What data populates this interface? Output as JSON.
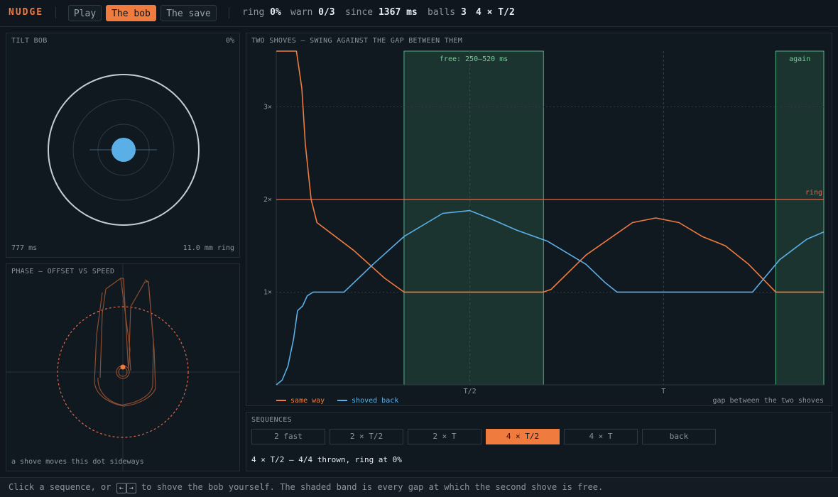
{
  "app": {
    "brand": "NUDGE"
  },
  "tabs": [
    {
      "label": "Play",
      "active": false
    },
    {
      "label": "The bob",
      "active": true
    },
    {
      "label": "The save",
      "active": false
    }
  ],
  "stats": {
    "ring_label": "ring",
    "ring_value": "0%",
    "warn_label": "warn",
    "warn_value": "0/3",
    "since_label": "since",
    "since_value": "1367 ms",
    "balls_label": "balls",
    "balls_value": "3",
    "sequence_value": "4 × T/2"
  },
  "tilt": {
    "title": "TILT BOB",
    "percent": "0%",
    "time": "777 ms",
    "ring_text": "11.0 mm ring"
  },
  "phase": {
    "title": "PHASE — OFFSET VS SPEED",
    "caption": "a shove moves this dot sideways"
  },
  "chart": {
    "title": "TWO SHOVES — SWING AGAINST THE GAP BETWEEN THEM",
    "free_label": "free: 250–520 ms",
    "again_label": "again",
    "ring_line_label": "ring",
    "caption": "gap between the two shoves",
    "y_ticks": [
      "1×",
      "2×",
      "3×"
    ],
    "x_ticks": [
      "T/2",
      "T"
    ]
  },
  "chart_data": {
    "type": "line",
    "title": "TWO SHOVES — SWING AGAINST THE GAP BETWEEN THEM",
    "xlabel": "gap between the two shoves",
    "x_ticks": [
      "T/2",
      "T"
    ],
    "y_ticks": [
      1,
      2,
      3
    ],
    "tick_suffix": "×",
    "ylim": [
      0,
      3.6
    ],
    "x_range": [
      0,
      1.414
    ],
    "ring_threshold": 2,
    "bands": [
      {
        "label": "free: 250–520 ms",
        "x0": 0.33,
        "x1": 0.69
      },
      {
        "label": "again",
        "x0": 1.29,
        "x1": 1.414
      }
    ],
    "series": [
      {
        "name": "same way",
        "color": "#ef7b3e",
        "points": [
          [
            0,
            3.6
          ],
          [
            0.052,
            3.6
          ],
          [
            0.066,
            3.2
          ],
          [
            0.075,
            2.6
          ],
          [
            0.09,
            2.0
          ],
          [
            0.105,
            1.75
          ],
          [
            0.2,
            1.45
          ],
          [
            0.28,
            1.15
          ],
          [
            0.33,
            1.0
          ],
          [
            0.69,
            1.0
          ],
          [
            0.71,
            1.03
          ],
          [
            0.8,
            1.4
          ],
          [
            0.92,
            1.75
          ],
          [
            0.98,
            1.8
          ],
          [
            1.04,
            1.75
          ],
          [
            1.1,
            1.6
          ],
          [
            1.16,
            1.5
          ],
          [
            1.22,
            1.3
          ],
          [
            1.29,
            1.0
          ],
          [
            1.414,
            1.0
          ]
        ]
      },
      {
        "name": "shoved back",
        "color": "#5aafe6",
        "points": [
          [
            0,
            0
          ],
          [
            0.015,
            0.05
          ],
          [
            0.03,
            0.2
          ],
          [
            0.045,
            0.5
          ],
          [
            0.055,
            0.8
          ],
          [
            0.068,
            0.85
          ],
          [
            0.08,
            0.96
          ],
          [
            0.095,
            1.0
          ],
          [
            0.175,
            1.0
          ],
          [
            0.25,
            1.3
          ],
          [
            0.33,
            1.6
          ],
          [
            0.43,
            1.85
          ],
          [
            0.5,
            1.88
          ],
          [
            0.56,
            1.78
          ],
          [
            0.62,
            1.67
          ],
          [
            0.7,
            1.55
          ],
          [
            0.8,
            1.3
          ],
          [
            0.85,
            1.1
          ],
          [
            0.88,
            1.0
          ],
          [
            1.23,
            1.0
          ],
          [
            1.3,
            1.35
          ],
          [
            1.37,
            1.57
          ],
          [
            1.414,
            1.65
          ]
        ]
      }
    ]
  },
  "sequences": {
    "title": "SEQUENCES",
    "buttons": [
      {
        "label": "2 fast",
        "active": false
      },
      {
        "label": "2 × T/2",
        "active": false
      },
      {
        "label": "2 × T",
        "active": false
      },
      {
        "label": "4 × T/2",
        "active": true
      },
      {
        "label": "4 × T",
        "active": false
      },
      {
        "label": "back",
        "active": false
      }
    ],
    "status": "4 × T/2 — 4/4 thrown, ring at 0%"
  },
  "footer": {
    "text_before": "Click a sequence, or",
    "key_left": "←",
    "key_right": "→",
    "text_after": "to shove the bob yourself. The shaded band is every gap at which the second shove is free."
  },
  "colors": {
    "accent": "#ef7b3e",
    "blue": "#5aafe6",
    "band": "#1e3a33",
    "band_edge": "#69d1a0",
    "ring_line": "#e0674a"
  }
}
